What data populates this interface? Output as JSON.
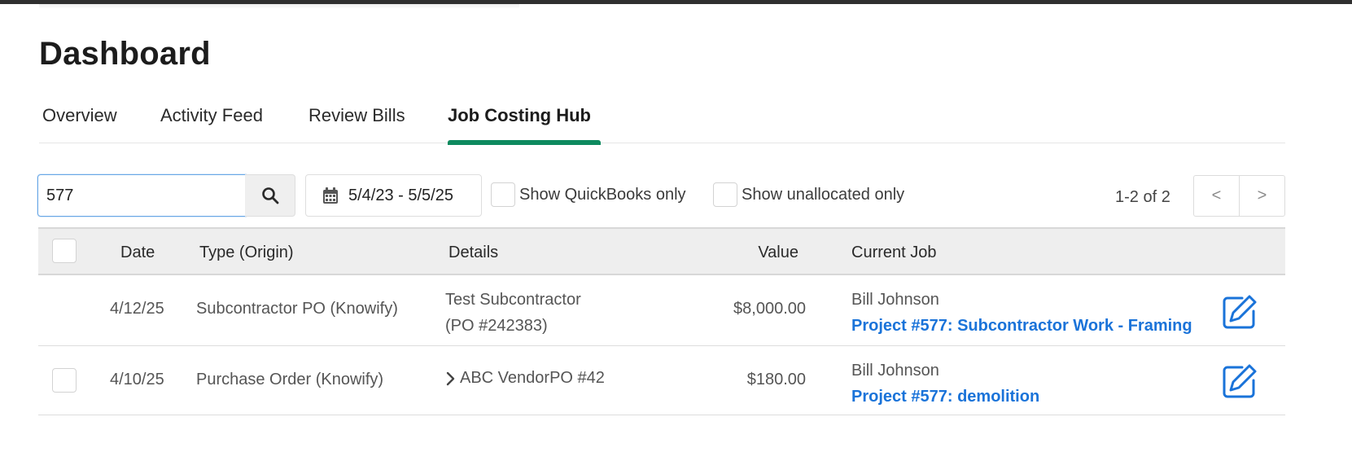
{
  "page": {
    "title": "Dashboard"
  },
  "tabs": [
    {
      "label": "Overview",
      "active": false
    },
    {
      "label": "Activity Feed",
      "active": false
    },
    {
      "label": "Review Bills",
      "active": false
    },
    {
      "label": "Job Costing Hub",
      "active": true
    }
  ],
  "filters": {
    "search_value": "577",
    "search_icon": "search-icon",
    "date_range": "5/4/23 - 5/5/25",
    "date_icon": "calendar-icon",
    "show_quickbooks_label": "Show QuickBooks only",
    "show_unallocated_label": "Show unallocated only"
  },
  "pagination": {
    "summary": "1-2 of 2",
    "prev": "<",
    "next": ">"
  },
  "table": {
    "columns": {
      "date": "Date",
      "type": "Type (Origin)",
      "details": "Details",
      "value": "Value",
      "current_job": "Current Job"
    },
    "rows": [
      {
        "date": "4/12/25",
        "type": "Subcontractor PO (Knowify)",
        "details_line1": "Test Subcontractor",
        "details_line2": "(PO #242383)",
        "value": "$8,000.00",
        "job_client": "Bill Johnson",
        "job_link": "Project #577: Subcontractor Work - Framing"
      },
      {
        "date": "4/10/25",
        "type": "Purchase Order (Knowify)",
        "details_line1": "ABC VendorPO #42",
        "value": "$180.00",
        "job_client": "Bill Johnson",
        "job_link": "Project #577: demolition"
      }
    ]
  },
  "colors": {
    "accent_tab": "#0e8a5f",
    "link": "#1a73d9",
    "header_bg": "#eeeeee"
  }
}
